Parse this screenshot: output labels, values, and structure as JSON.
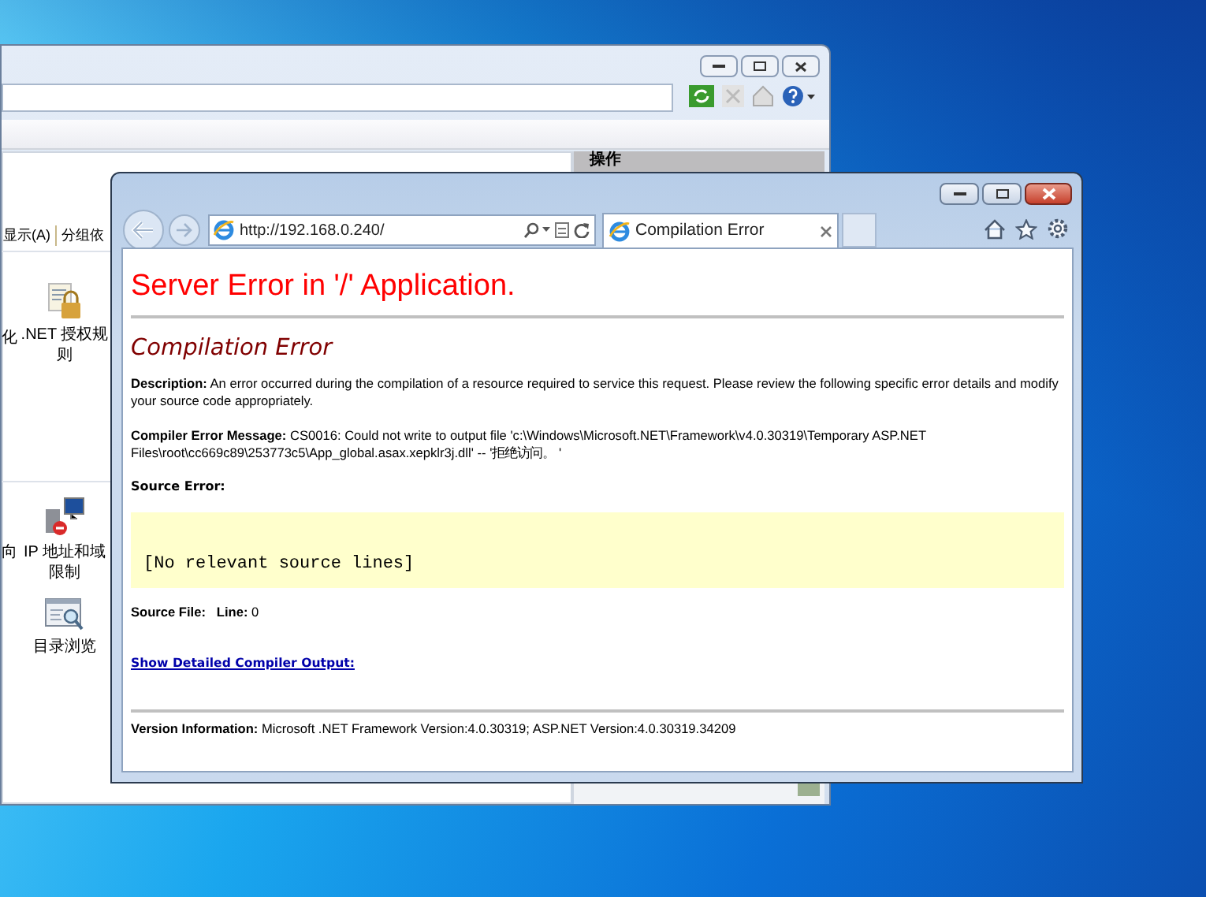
{
  "background_window": {
    "menu_items": [
      "显示(A)",
      "分组依"
    ],
    "pane_title": "操作",
    "features": [
      {
        "kind": "label",
        "label": "化"
      },
      {
        "kind": "lock",
        "label": ".NET 授权规则"
      },
      {
        "kind": "label",
        "label": "向"
      },
      {
        "kind": "network",
        "label": "IP 地址和域限制"
      },
      {
        "kind": "browse",
        "label": "目录浏览"
      }
    ]
  },
  "browser": {
    "address": "http://192.168.0.240/",
    "tabs": [
      {
        "title": "Compilation Error",
        "selected": true
      }
    ],
    "page": {
      "heading": "Server Error in '/' Application.",
      "subheading": "Compilation Error",
      "description": "**Description:** An error occurred during the compilation of a resource required to service this request. Please review the following specific error details and modify your source code appropriately.",
      "compiler_message": "**Compiler Error Message:** CS0016: Could not write to output file 'c:\\Windows\\Microsoft.NET\\Framework\\v4.0.30319\\Temporary ASP.NET Files\\root\\cc669c89\\253773c5\\App_global.asax.xepklr3j.dll' -- '拒绝访问。 '",
      "source_error_label": "Source Error:",
      "source_code": "[No relevant source lines]",
      "source_file": "**Source File:**   **Line:** 0",
      "link": "Show Detailed Compiler Output:",
      "version": "**Version Information:** Microsoft .NET Framework Version:4.0.30319; ASP.NET Version:4.0.30319.34209"
    }
  }
}
